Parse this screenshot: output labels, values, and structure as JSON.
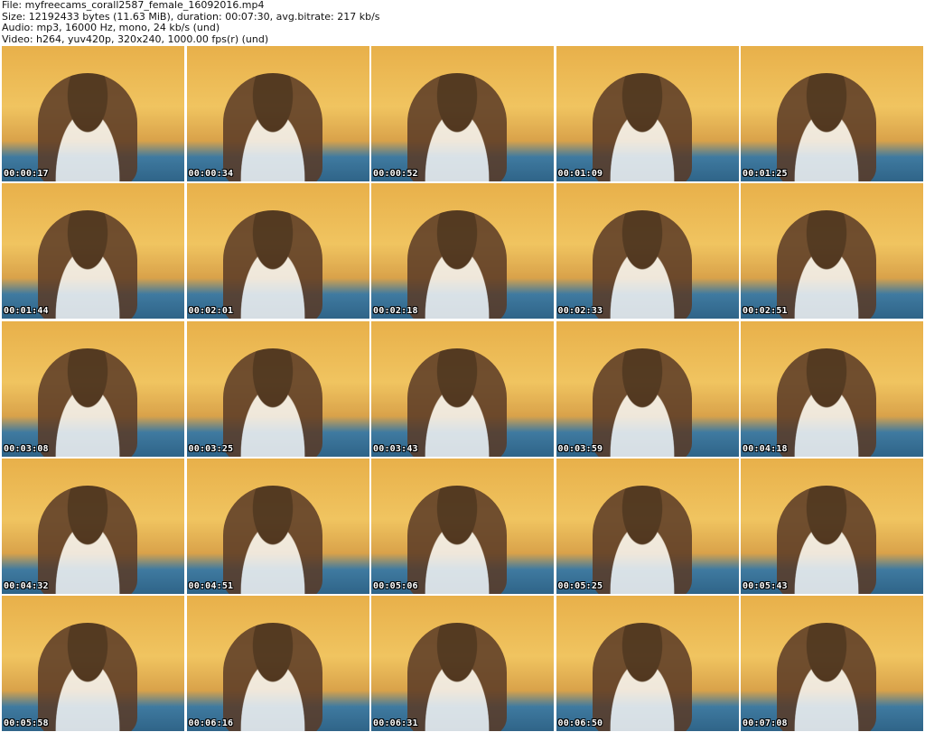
{
  "header": {
    "file_line": "File: myfreecams_corall2587_female_16092016.mp4",
    "size_line": "Size: 12192433 bytes (11.63 MiB), duration: 00:07:30, avg.bitrate: 217 kb/s",
    "audio_line": "Audio: mp3, 16000 Hz, mono, 24 kb/s (und)",
    "video_line": "Video: h264, yuv420p, 320x240, 1000.00 fps(r) (und)"
  },
  "thumbnails": [
    {
      "timestamp": "00:00:17"
    },
    {
      "timestamp": "00:00:34"
    },
    {
      "timestamp": "00:00:52"
    },
    {
      "timestamp": "00:01:09"
    },
    {
      "timestamp": "00:01:25"
    },
    {
      "timestamp": "00:01:44"
    },
    {
      "timestamp": "00:02:01"
    },
    {
      "timestamp": "00:02:18"
    },
    {
      "timestamp": "00:02:33"
    },
    {
      "timestamp": "00:02:51"
    },
    {
      "timestamp": "00:03:08"
    },
    {
      "timestamp": "00:03:25"
    },
    {
      "timestamp": "00:03:43"
    },
    {
      "timestamp": "00:03:59"
    },
    {
      "timestamp": "00:04:18"
    },
    {
      "timestamp": "00:04:32"
    },
    {
      "timestamp": "00:04:51"
    },
    {
      "timestamp": "00:05:06"
    },
    {
      "timestamp": "00:05:25"
    },
    {
      "timestamp": "00:05:43"
    },
    {
      "timestamp": "00:05:58"
    },
    {
      "timestamp": "00:06:16"
    },
    {
      "timestamp": "00:06:31"
    },
    {
      "timestamp": "00:06:50"
    },
    {
      "timestamp": "00:07:08"
    }
  ]
}
